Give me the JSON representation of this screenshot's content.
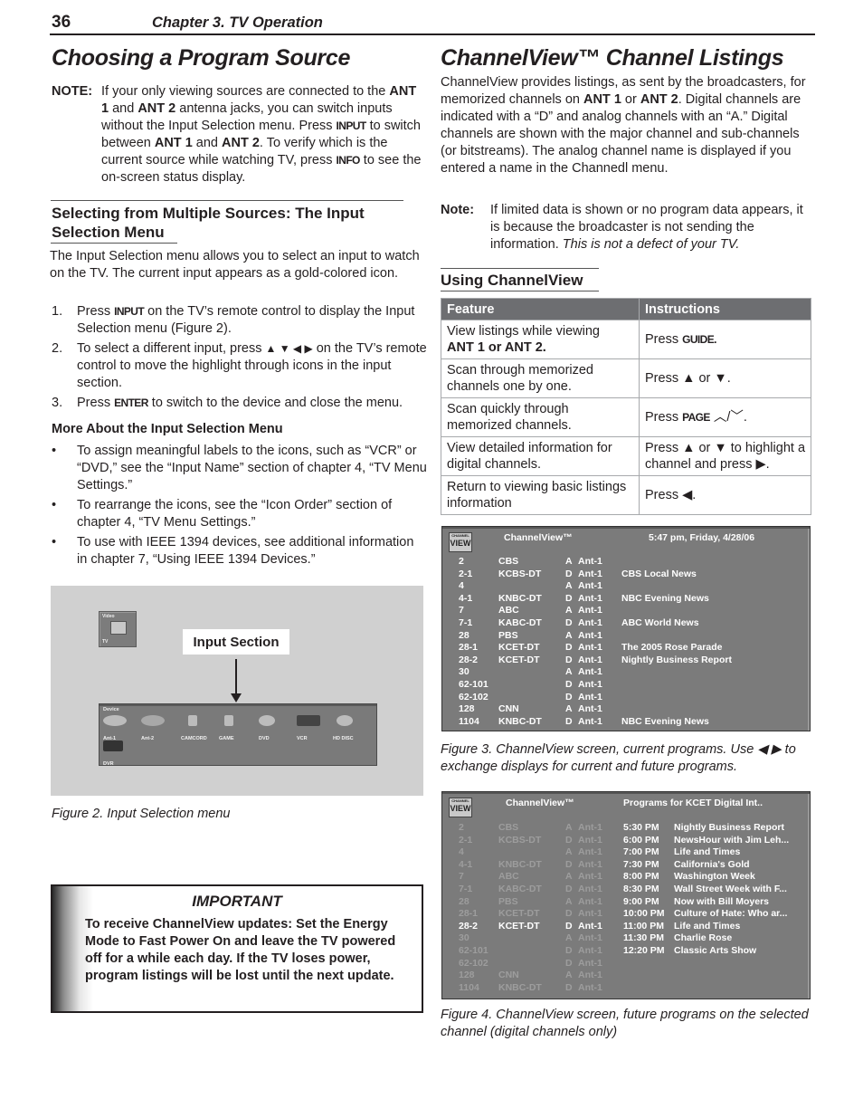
{
  "header": {
    "page_number": "36",
    "chapter": "Chapter 3. TV Operation"
  },
  "left": {
    "title": "Choosing a Program Source",
    "note": {
      "label": "NOTE:",
      "parts": [
        "If your only viewing sources are connected to the ",
        "ANT 1",
        " and ",
        "ANT 2",
        " antenna jacks, you can switch inputs without the Input Selection menu.  Press ",
        "INPUT",
        " to switch between ",
        "ANT 1",
        " and ",
        "ANT 2",
        ".  To verify which is the current source while watching TV, press ",
        "INFO",
        " to see the on-screen status display."
      ]
    },
    "section_heading": "Selecting from Multiple Sources:  The Input Selection Menu",
    "intro": "The Input Selection menu allows you to select an input to watch on the TV.  The current input appears as a gold-colored icon.",
    "steps": [
      {
        "num": "1.",
        "pre": "Press ",
        "key": "INPUT",
        "post": " on the TV’s remote control to display the Input Selection menu (Figure 2)."
      },
      {
        "num": "2.",
        "pre": "To select a different input, press ",
        "key": "▲ ▼ ◀ ▶",
        "post": " on the TV’s remote control to move the highlight through icons in the input section."
      },
      {
        "num": "3.",
        "pre": "Press ",
        "key": "ENTER",
        "post": " to switch to the device and close the menu."
      }
    ],
    "more_heading": "More About the Input Selection Menu",
    "bullets": [
      "To assign meaningful labels to the icons, such as “VCR” or “DVD,” see the “Input Name” section of chapter 4, “TV Menu Settings.”",
      "To rearrange the icons, see the “Icon Order” section of chapter 4, “TV Menu Settings.”",
      "To use with IEEE 1394 devices, see additional information in chapter 7, “Using IEEE 1394 Devices.”"
    ],
    "figure2": {
      "video_box_top": "Video",
      "video_box_bottom": "TV",
      "callout": "Input Section",
      "device_label": "Device",
      "devices": [
        "Ant-1",
        "Ant-2",
        "CAMCORD",
        "GAME",
        "DVD",
        "VCR",
        "HD DISC",
        "DVR"
      ],
      "caption": "Figure 2.  Input Selection menu"
    },
    "important": {
      "title": "IMPORTANT",
      "text": "To receive ChannelView updates:   Set the Energy Mode to Fast Power On and leave the TV powered off for a while each day.   If the TV loses power, program listings will be lost until the next update."
    }
  },
  "right": {
    "title": "ChannelView™ Channel Listings",
    "intro_parts": [
      "ChannelView provides listings, as sent by the broadcasters, for memorized channels on ",
      "ANT 1",
      " or ",
      "ANT 2",
      ".  Digital channels are indicated with a “D” and analog channels with an “A.”  Digital channels are shown with the major channel and sub-channels (or bitstreams).  The analog channel name is displayed if you entered a name in the Channedl menu."
    ],
    "note": {
      "label": "Note:",
      "text": "If limited data is shown or no program data appears, it is because the broadcaster is not sending the information.  ",
      "italic": "This is not a defect of your TV."
    },
    "using_heading": "Using ChannelView",
    "table": {
      "headers": [
        "Feature",
        "Instructions"
      ],
      "rows": [
        {
          "feature": "View listings while viewing",
          "feature_bold": "ANT 1 or ANT 2.",
          "instr_pre": "Press ",
          "instr_key": "GUIDE.",
          "instr_post": ""
        },
        {
          "feature": "Scan through memorized channels one by one.",
          "feature_bold": "",
          "instr_pre": "Press ▲ or ▼.",
          "instr_key": "",
          "instr_post": ""
        },
        {
          "feature": "Scan quickly through memorized channels.",
          "feature_bold": "",
          "instr_pre": "Press ",
          "instr_key": "PAGE",
          "instr_post": " ︿/﹀."
        },
        {
          "feature": "View detailed information for digital channels.",
          "feature_bold": "",
          "instr_pre": "Press ▲ or ▼ to highlight a channel and press  ▶.",
          "instr_key": "",
          "instr_post": ""
        },
        {
          "feature": "Return to viewing  basic listings information",
          "feature_bold": "",
          "instr_pre": "Press ◀.",
          "instr_key": "",
          "instr_post": ""
        }
      ]
    },
    "figure3": {
      "logo_small": "CHANNEL",
      "logo_big": "VIEW",
      "title": "ChannelView™",
      "datetime": "5:47 pm, Friday, 4/28/06",
      "rows": [
        {
          "ch": "2",
          "name": "CBS",
          "type": "A",
          "src": "Ant-1",
          "program": ""
        },
        {
          "ch": "2-1",
          "name": "KCBS-DT",
          "type": "D",
          "src": "Ant-1",
          "program": "CBS Local News"
        },
        {
          "ch": "4",
          "name": "",
          "type": "A",
          "src": "Ant-1",
          "program": ""
        },
        {
          "ch": "4-1",
          "name": "KNBC-DT",
          "type": "D",
          "src": "Ant-1",
          "program": "NBC Evening News"
        },
        {
          "ch": "7",
          "name": "ABC",
          "type": "A",
          "src": "Ant-1",
          "program": ""
        },
        {
          "ch": "7-1",
          "name": "KABC-DT",
          "type": "D",
          "src": "Ant-1",
          "program": "ABC World News"
        },
        {
          "ch": "28",
          "name": "PBS",
          "type": "A",
          "src": "Ant-1",
          "program": ""
        },
        {
          "ch": "28-1",
          "name": "KCET-DT",
          "type": "D",
          "src": "Ant-1",
          "program": "The 2005 Rose Parade"
        },
        {
          "ch": "28-2",
          "name": "KCET-DT",
          "type": "D",
          "src": "Ant-1",
          "program": "Nightly Business Report"
        },
        {
          "ch": "30",
          "name": "",
          "type": "A",
          "src": "Ant-1",
          "program": ""
        },
        {
          "ch": "62-101",
          "name": "",
          "type": "D",
          "src": "Ant-1",
          "program": ""
        },
        {
          "ch": "62-102",
          "name": "",
          "type": "D",
          "src": "Ant-1",
          "program": ""
        },
        {
          "ch": "128",
          "name": "CNN",
          "type": "A",
          "src": "Ant-1",
          "program": ""
        },
        {
          "ch": "1104",
          "name": "KNBC-DT",
          "type": "D",
          "src": "Ant-1",
          "program": "NBC Evening News"
        }
      ],
      "caption": "Figure 3. ChannelView screen, current programs.  Use ◀ ▶ to exchange displays for current and future programs."
    },
    "figure4": {
      "logo_small": "CHANNEL",
      "logo_big": "VIEW",
      "title": "ChannelView™",
      "subtitle": "Programs for KCET Digital Int..",
      "selected_index": 8,
      "channels": [
        {
          "ch": "2",
          "name": "CBS",
          "type": "A",
          "src": "Ant-1"
        },
        {
          "ch": "2-1",
          "name": "KCBS-DT",
          "type": "D",
          "src": "Ant-1"
        },
        {
          "ch": "4",
          "name": "",
          "type": "A",
          "src": "Ant-1"
        },
        {
          "ch": "4-1",
          "name": "KNBC-DT",
          "type": "D",
          "src": "Ant-1"
        },
        {
          "ch": "7",
          "name": "ABC",
          "type": "A",
          "src": "Ant-1"
        },
        {
          "ch": "7-1",
          "name": "KABC-DT",
          "type": "D",
          "src": "Ant-1"
        },
        {
          "ch": "28",
          "name": "PBS",
          "type": "A",
          "src": "Ant-1"
        },
        {
          "ch": "28-1",
          "name": "KCET-DT",
          "type": "D",
          "src": "Ant-1"
        },
        {
          "ch": "28-2",
          "name": "KCET-DT",
          "type": "D",
          "src": "Ant-1"
        },
        {
          "ch": "30",
          "name": "",
          "type": "A",
          "src": "Ant-1"
        },
        {
          "ch": "62-101",
          "name": "",
          "type": "D",
          "src": "Ant-1"
        },
        {
          "ch": "62-102",
          "name": "",
          "type": "D",
          "src": "Ant-1"
        },
        {
          "ch": "128",
          "name": "CNN",
          "type": "A",
          "src": "Ant-1"
        },
        {
          "ch": "1104",
          "name": "KNBC-DT",
          "type": "D",
          "src": "Ant-1"
        }
      ],
      "schedule": [
        {
          "time": "5:30 PM",
          "program": "Nightly Business Report"
        },
        {
          "time": "6:00 PM",
          "program": "NewsHour with Jim Leh..."
        },
        {
          "time": "7:00 PM",
          "program": "Life and Times"
        },
        {
          "time": "7:30 PM",
          "program": "California's Gold"
        },
        {
          "time": "8:00 PM",
          "program": "Washington Week"
        },
        {
          "time": "8:30 PM",
          "program": "Wall Street Week with F..."
        },
        {
          "time": "9:00 PM",
          "program": "Now with Bill Moyers"
        },
        {
          "time": "10:00 PM",
          "program": "Culture of Hate: Who ar..."
        },
        {
          "time": "11:00 PM",
          "program": "Life and Times"
        },
        {
          "time": "11:30 PM",
          "program": "Charlie Rose"
        },
        {
          "time": "12:20 PM",
          "program": "Classic Arts Show"
        }
      ],
      "caption": "Figure 4. ChannelView screen, future programs on the selected channel (digital channels only)"
    }
  }
}
